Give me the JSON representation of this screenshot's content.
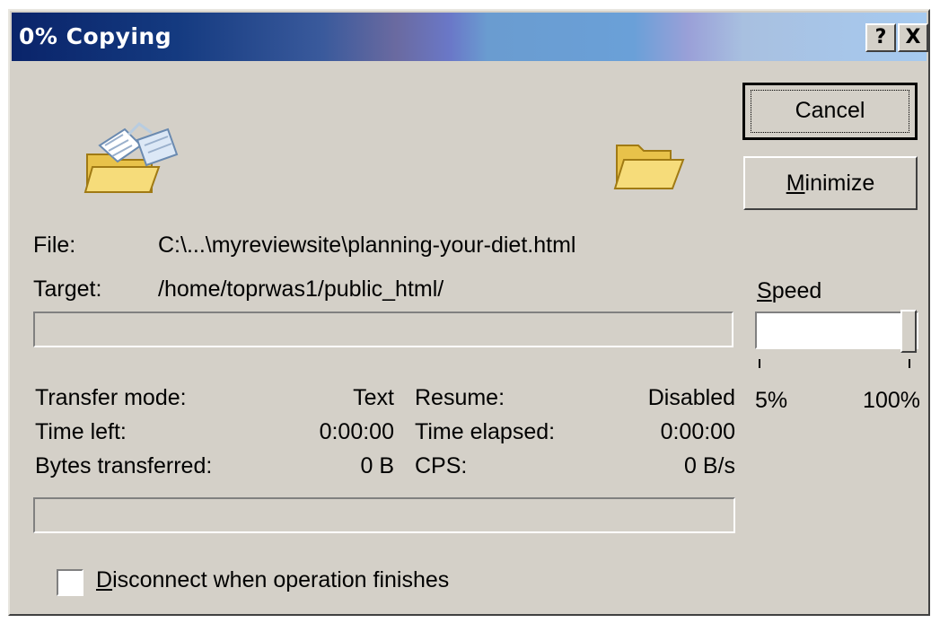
{
  "window": {
    "title": "0% Copying",
    "help_button": "?",
    "close_button": "X"
  },
  "buttons": {
    "cancel": "Cancel",
    "minimize_prefix": "M",
    "minimize_rest": "inimize"
  },
  "icons": {
    "source": "flying-papers-folder-icon",
    "target": "open-folder-icon"
  },
  "file": {
    "label": "File:",
    "value": "C:\\...\\myreviewsite\\planning-your-diet.html"
  },
  "target": {
    "label": "Target:",
    "value": "/home/toprwas1/public_html/"
  },
  "speed": {
    "label_prefix": "S",
    "label_rest": "peed",
    "min_label": "5%",
    "max_label": "100%",
    "value_percent": 100
  },
  "stats": {
    "transfer_mode_label": "Transfer mode:",
    "transfer_mode_value": "Text",
    "resume_label": "Resume:",
    "resume_value": "Disabled",
    "time_left_label": "Time left:",
    "time_left_value": "0:00:00",
    "time_elapsed_label": "Time elapsed:",
    "time_elapsed_value": "0:00:00",
    "bytes_label": "Bytes transferred:",
    "bytes_value": "0 B",
    "cps_label": "CPS:",
    "cps_value": "0 B/s"
  },
  "progress": {
    "file_percent": 0,
    "total_percent": 0
  },
  "disconnect": {
    "label_prefix": "D",
    "label_rest": "isconnect when operation finishes",
    "checked": false
  },
  "colors": {
    "face": "#d4d0c8",
    "title_start": "#0a246a",
    "title_end": "#a6caf0"
  }
}
